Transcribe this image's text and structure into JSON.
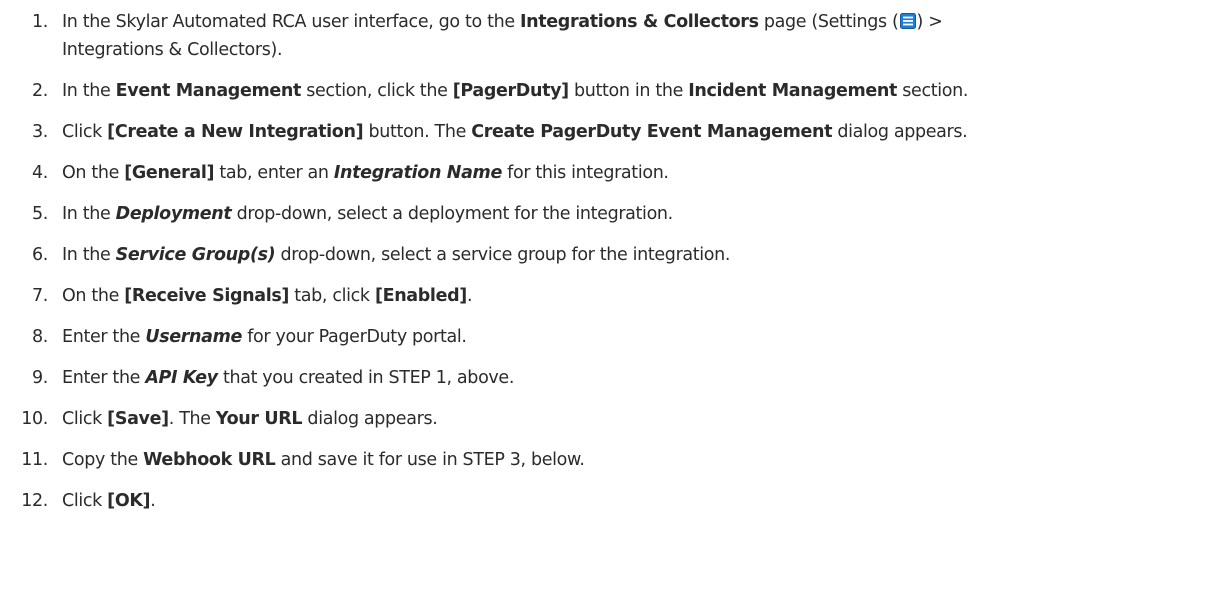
{
  "steps": [
    {
      "num": "1.",
      "line1_a": "In the Skylar Automated RCA user interface, go to the ",
      "line1_b": "Integrations & Collectors",
      "line1_c": " page (Settings (",
      "line1_d": ") >",
      "line2": "Integrations & Collectors)."
    },
    {
      "num": "2.",
      "a": "In the ",
      "b": "Event Management",
      "c": " section, click the ",
      "d": "[PagerDuty]",
      "e": " button in the ",
      "f": "Incident Management",
      "g": " section."
    },
    {
      "num": "3.",
      "a": "Click ",
      "b": "[Create a New Integration]",
      "c": " button. The ",
      "d": "Create PagerDuty Event Management",
      "e": " dialog appears."
    },
    {
      "num": "4.",
      "a": "On the ",
      "b": "[General]",
      "c": " tab, enter an ",
      "d": "Integration Name",
      "e": " for this integration."
    },
    {
      "num": "5.",
      "a": "In the ",
      "b": "Deployment",
      "c": " drop-down, select a deployment for the integration."
    },
    {
      "num": "6.",
      "a": "In the ",
      "b": "Service Group(s)",
      "c": " drop-down, select a service group for the integration."
    },
    {
      "num": "7.",
      "a": "On the ",
      "b": "[Receive Signals]",
      "c": " tab, click ",
      "d": "[Enabled]",
      "e": "."
    },
    {
      "num": "8.",
      "a": "Enter the ",
      "b": "Username",
      "c": " for your PagerDuty portal."
    },
    {
      "num": "9.",
      "a": "Enter the ",
      "b": "API Key",
      "c": " that you created in STEP 1, above."
    },
    {
      "num": "10.",
      "a": "Click ",
      "b": "[Save]",
      "c": ". The ",
      "d": "Your URL",
      "e": " dialog appears."
    },
    {
      "num": "11.",
      "a": "Copy the ",
      "b": "Webhook URL",
      "c": " and save it for use in STEP 3, below."
    },
    {
      "num": "12.",
      "a": "Click ",
      "b": "[OK]",
      "c": "."
    }
  ],
  "icons": {
    "settings_menu_icon": "hamburger-menu-icon",
    "accent": "#1f7fd6"
  }
}
